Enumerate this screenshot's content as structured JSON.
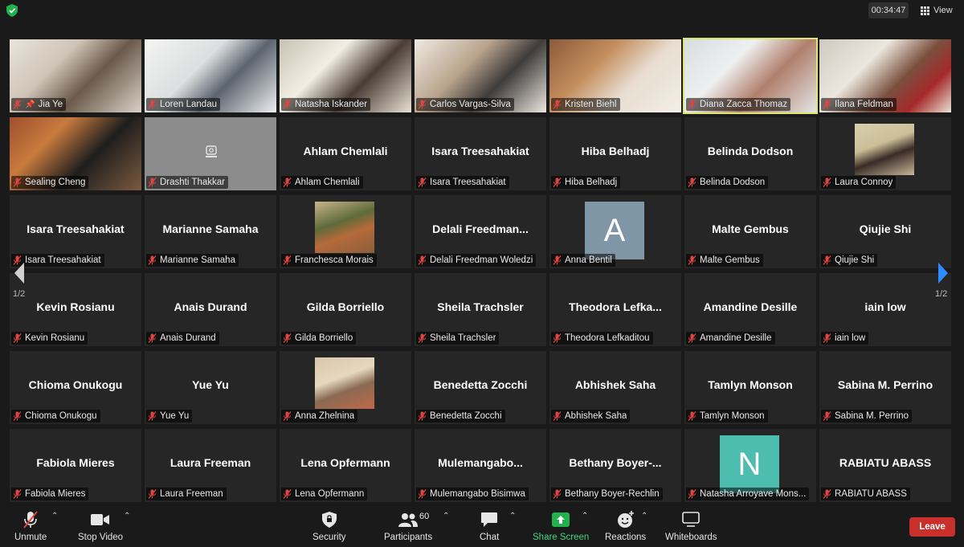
{
  "meeting": {
    "timer": "00:34:47",
    "view_label": "View",
    "page_indicator_left": "1/2",
    "page_indicator_right": "1/2"
  },
  "participants": [
    {
      "name": "Jia Ye",
      "label": "Jia Ye",
      "video": true,
      "pinned": true
    },
    {
      "name": "Loren Landau",
      "label": "Loren Landau",
      "video": true
    },
    {
      "name": "Natasha Iskander",
      "label": "Natasha Iskander",
      "video": true
    },
    {
      "name": "Carlos Vargas-Silva",
      "label": "Carlos Vargas-Silva",
      "video": true
    },
    {
      "name": "Kristen Biehl",
      "label": "Kristen Biehl",
      "video": true
    },
    {
      "name": "Diana Zacca Thomaz",
      "label": "Diana Zacca Thomaz",
      "video": true,
      "active_speaker": true
    },
    {
      "name": "Ilana Feldman",
      "label": "Ilana Feldman",
      "video": true
    },
    {
      "name": "Sealing Cheng",
      "label": "Sealing Cheng",
      "video": true
    },
    {
      "name": "Drashti Thakkar",
      "label": "Drashti Thakkar",
      "camera_off_icon": true
    },
    {
      "name": "Ahlam Chemlali",
      "label": "Ahlam Chemlali"
    },
    {
      "name": "Isara Treesahakiat",
      "label": "Isara Treesahakiat"
    },
    {
      "name": "Hiba Belhadj",
      "label": "Hiba Belhadj"
    },
    {
      "name": "Belinda Dodson",
      "label": "Belinda Dodson"
    },
    {
      "name": "Laura Connoy",
      "label": "Laura Connoy",
      "profile_photo": true
    },
    {
      "name": "Isara Treesahakiat",
      "label": "Isara Treesahakiat"
    },
    {
      "name": "Marianne Samaha",
      "label": "Marianne Samaha"
    },
    {
      "name": "Franchesca Morais",
      "label": "Franchesca Morais",
      "profile_photo": true
    },
    {
      "name": "Delali  Freedman...",
      "label": "Delali Freedman Woledzi"
    },
    {
      "name": "Anna Bentil",
      "label": "Anna Bentil",
      "letter": "A",
      "letter_color": "#7e96a6"
    },
    {
      "name": "Malte Gembus",
      "label": "Malte Gembus"
    },
    {
      "name": "Qiujie Shi",
      "label": "Qiujie Shi"
    },
    {
      "name": "Kevin Rosianu",
      "label": "Kevin Rosianu"
    },
    {
      "name": "Anais Durand",
      "label": "Anais Durand"
    },
    {
      "name": "Gilda Borriello",
      "label": "Gilda Borriello"
    },
    {
      "name": "Sheila Trachsler",
      "label": "Sheila Trachsler"
    },
    {
      "name": "Theodora  Lefka...",
      "label": "Theodora Lefkaditou"
    },
    {
      "name": "Amandine Desille",
      "label": "Amandine Desille"
    },
    {
      "name": "iain low",
      "label": "iain low"
    },
    {
      "name": "Chioma Onukogu",
      "label": "Chioma Onukogu"
    },
    {
      "name": "Yue Yu",
      "label": "Yue Yu"
    },
    {
      "name": "Anna Zhelnina",
      "label": "Anna Zhelnina",
      "profile_photo": true
    },
    {
      "name": "Benedetta Zocchi",
      "label": "Benedetta Zocchi"
    },
    {
      "name": "Abhishek Saha",
      "label": "Abhishek Saha"
    },
    {
      "name": "Tamlyn Monson",
      "label": "Tamlyn Monson"
    },
    {
      "name": "Sabina M. Perrino",
      "label": "Sabina M. Perrino"
    },
    {
      "name": "Fabiola Mieres",
      "label": "Fabiola Mieres"
    },
    {
      "name": "Laura Freeman",
      "label": "Laura Freeman"
    },
    {
      "name": "Lena Opfermann",
      "label": "Lena Opfermann"
    },
    {
      "name": "Mulemangabo...",
      "label": "Mulemangabo Bisimwa"
    },
    {
      "name": "Bethany  Boyer-...",
      "label": "Bethany Boyer-Rechlin"
    },
    {
      "name": "Natasha Arroyave Mons...",
      "label": "Natasha Arroyave Mons...",
      "letter": "N",
      "letter_color": "#4dbdb0"
    },
    {
      "name": "RABIATU ABASS",
      "label": "RABIATU ABASS"
    }
  ],
  "toolbar": {
    "unmute": "Unmute",
    "stop_video": "Stop Video",
    "security": "Security",
    "participants": "Participants",
    "participant_count": "60",
    "chat": "Chat",
    "share_screen": "Share Screen",
    "reactions": "Reactions",
    "whiteboards": "Whiteboards",
    "leave": "Leave"
  },
  "colors": {
    "background": "#1a1a1a",
    "tile": "#262626",
    "active_speaker_border": "#dfe66f",
    "share_green": "#3fd67a",
    "leave_red": "#c9302c",
    "muted_red": "#e0443f"
  }
}
